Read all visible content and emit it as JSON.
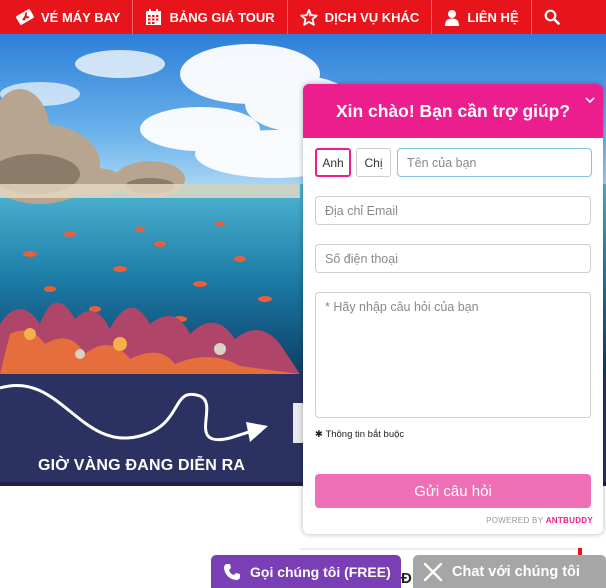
{
  "nav": {
    "items": [
      {
        "label": "VÉ MÁY BAY",
        "icon": "plane-ticket-icon"
      },
      {
        "label": "BẢNG GIÁ TOUR",
        "icon": "calendar-icon"
      },
      {
        "label": "DỊCH VỤ KHÁC",
        "icon": "star-icon"
      },
      {
        "label": "LIÊN HỆ",
        "icon": "user-icon"
      }
    ],
    "search_icon": "search-icon",
    "background": "#e8141c"
  },
  "promo": {
    "text": "GIỜ VÀNG ĐANG DIỄN RA",
    "background": "#2b3160"
  },
  "chat_widget": {
    "title": "Xin chào! Bạn cần trợ giúp?",
    "gender_options": [
      "Anh",
      "Chị"
    ],
    "selected_gender": "Anh",
    "name_placeholder": "Tên của bạn",
    "email_placeholder": "Địa chỉ Email",
    "phone_placeholder": "Số điện thoại",
    "question_placeholder": "* Hãy nhập câu hỏi của bạn",
    "required_note": "Thông tin bắt buộc",
    "submit_label": "Gửi câu hỏi",
    "powered_prefix": "POWERED BY ",
    "powered_brand": "ANTBUDDY",
    "accent": "#ec1e8e"
  },
  "bottom_bar": {
    "call_label": "Gọi chúng tôi (FREE)",
    "chat_label": "Chat với chúng tôi",
    "partial_letter": "Đ"
  }
}
